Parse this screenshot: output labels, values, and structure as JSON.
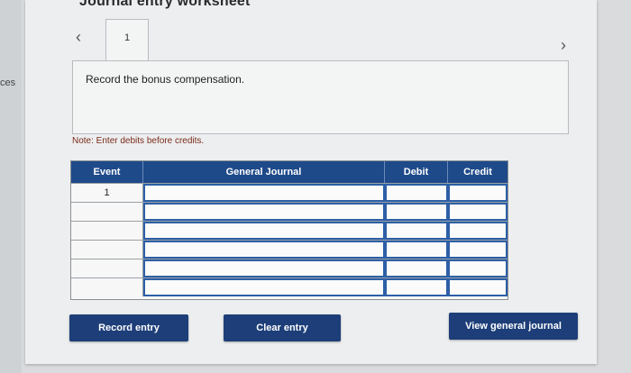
{
  "sidebar": {
    "clipped_text": "ces"
  },
  "worksheet": {
    "title": "Journal entry worksheet",
    "nav": {
      "prev_icon": "chevron-left-icon",
      "next_icon": "chevron-right-icon"
    },
    "tabs": [
      {
        "label": "1"
      }
    ],
    "prompt": "Record the bonus compensation.",
    "note": "Note: Enter debits before credits."
  },
  "table": {
    "headers": {
      "event": "Event",
      "general_journal": "General Journal",
      "debit": "Debit",
      "credit": "Credit"
    },
    "rows": [
      {
        "event": "1",
        "account": "",
        "debit": "",
        "credit": ""
      },
      {
        "event": "",
        "account": "",
        "debit": "",
        "credit": ""
      },
      {
        "event": "",
        "account": "",
        "debit": "",
        "credit": ""
      },
      {
        "event": "",
        "account": "",
        "debit": "",
        "credit": ""
      },
      {
        "event": "",
        "account": "",
        "debit": "",
        "credit": ""
      },
      {
        "event": "",
        "account": "",
        "debit": "",
        "credit": ""
      }
    ]
  },
  "buttons": {
    "record": "Record entry",
    "clear": "Clear entry",
    "view": "View general journal"
  },
  "colors": {
    "header_bg": "#1e4a8a",
    "button_bg": "#1d3e78",
    "input_border": "#2d5fa6",
    "note_text": "#7a2a1a"
  }
}
